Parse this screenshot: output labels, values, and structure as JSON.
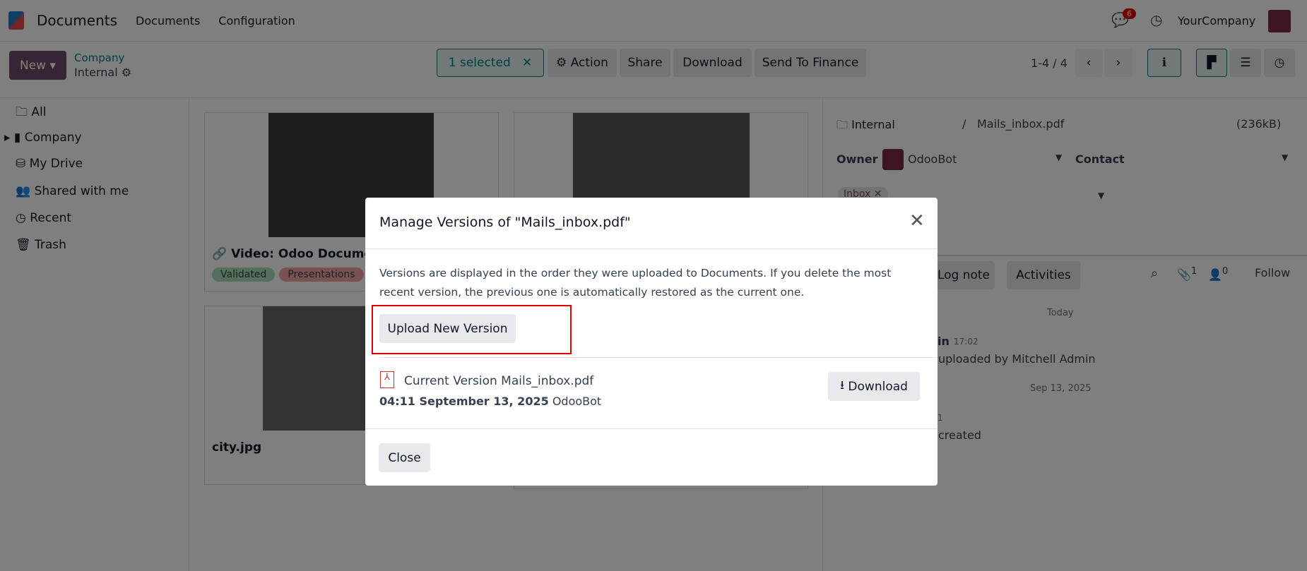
{
  "topbar": {
    "app": "Documents",
    "menu": [
      "Documents",
      "Configuration"
    ],
    "notif_count": "6",
    "company": "YourCompany"
  },
  "control": {
    "new": "New",
    "breadcrumb_parent": "Company",
    "breadcrumb_current": "Internal",
    "selected": "1 selected",
    "action": "Action",
    "share": "Share",
    "download": "Download",
    "send": "Send To Finance",
    "pager": "1-4 / 4"
  },
  "sidebar": [
    "All",
    "Company",
    "My Drive",
    "Shared with me",
    "Recent",
    "Trash"
  ],
  "cards": [
    {
      "title": "Video: Odoo Documents",
      "tags": [
        "Validated",
        "Presentations"
      ]
    },
    {
      "title": "city.jpg"
    }
  ],
  "details": {
    "folder": "Internal",
    "sep": "/",
    "filename": "Mails_inbox.pdf",
    "size": "(236kB)",
    "owner_label": "Owner",
    "owner": "OdooBot",
    "contact_label": "Contact",
    "tag": "Inbox"
  },
  "chatter": {
    "log_note": "Log note",
    "activities": "Activities",
    "attach_count": "1",
    "follower_count": "0",
    "follow": "Follow",
    "today": "Today",
    "msg1_author": "in",
    "msg1_time": "17:02",
    "msg1_body": "uploaded by Mitchell Admin",
    "date2": "Sep 13, 2025",
    "msg2_time": "1",
    "msg2_body": "created"
  },
  "modal": {
    "title": "Manage Versions of \"Mails_inbox.pdf\"",
    "description": "Versions are displayed in the order they were uploaded to Documents. If you delete the most recent version, the previous one is automatically restored as the current one.",
    "upload": "Upload New Version",
    "version_name": "Current Version Mails_inbox.pdf",
    "version_date": "04:11 September 13, 2025",
    "version_user": "OdooBot",
    "download": "Download",
    "close": "Close"
  },
  "colors": {
    "brand": "#714B67",
    "highlight": "#e00000"
  }
}
